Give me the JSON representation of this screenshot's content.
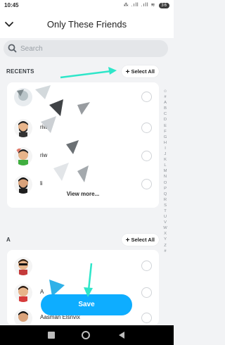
{
  "status_bar": {
    "time": "10:45",
    "signal_text": "⁂ .ıll .ıll ≋",
    "battery": "36"
  },
  "header": {
    "title": "Only These Friends"
  },
  "search": {
    "placeholder": "Search"
  },
  "recents": {
    "label": "RECENTS",
    "select_all": "Select All",
    "rows": [
      {
        "name": ""
      },
      {
        "name": "riw"
      },
      {
        "name": "riw"
      },
      {
        "name": "li"
      }
    ],
    "view_more": "View more..."
  },
  "section_a": {
    "label": "A",
    "select_all": "Select All",
    "rows": [
      {
        "name": ""
      },
      {
        "name": "A"
      },
      {
        "name": "Aasman Elsnvix"
      }
    ]
  },
  "index_letters": [
    "☺",
    "#",
    "A",
    "B",
    "C",
    "D",
    "E",
    "F",
    "G",
    "H",
    "I",
    "J",
    "K",
    "L",
    "M",
    "N",
    "O",
    "P",
    "Q",
    "R",
    "S",
    "T",
    "U",
    "V",
    "W",
    "X",
    "Y",
    "Z",
    "#"
  ],
  "save_button": {
    "label": "Save"
  },
  "colors": {
    "accent": "#0eadff",
    "annotation": "#2ee6c9"
  },
  "icons": {
    "back": "chevron-down-icon",
    "search": "search-icon",
    "plus": "plus-icon"
  }
}
